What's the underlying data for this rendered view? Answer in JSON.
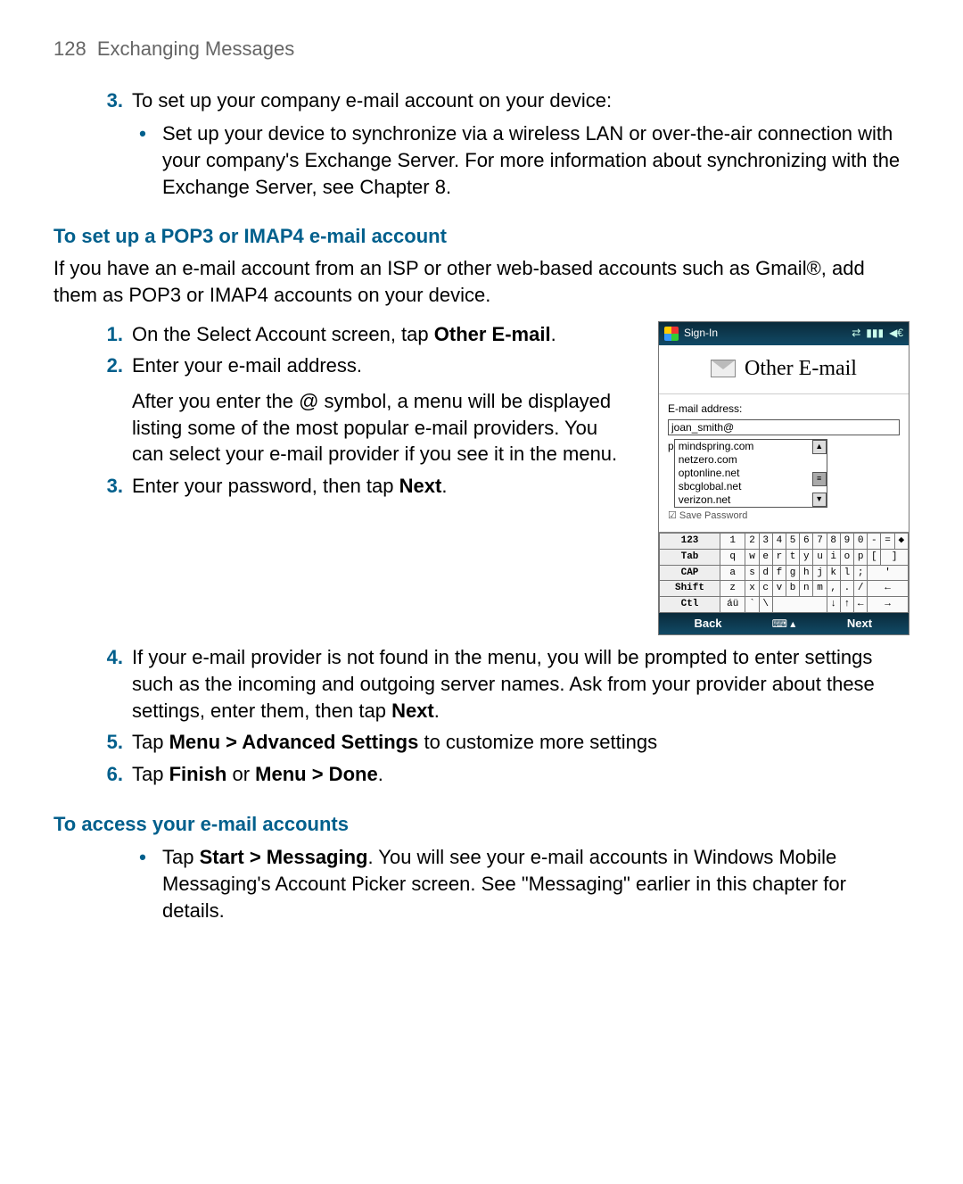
{
  "header": {
    "page_number": "128",
    "title": "Exchanging Messages"
  },
  "step3": {
    "num": "3.",
    "text": "To set up your company e-mail account on your device:",
    "bullet": "Set up your device to synchronize via a wireless LAN or over-the-air connection with your company's Exchange Server. For more information about synchronizing with the Exchange Server, see Chapter 8."
  },
  "sectionA": {
    "heading": "To set up a POP3 or IMAP4 e-mail account",
    "intro": "If you have an e-mail account from an ISP or other web-based accounts such as Gmail®, add them as POP3 or IMAP4 accounts on your device."
  },
  "pop_steps": {
    "s1_num": "1.",
    "s1_a": "On the Select Account screen, tap ",
    "s1_b": "Other E-mail",
    "s1_c": ".",
    "s2_num": "2.",
    "s2_a": "Enter your e-mail address.",
    "s2_b": "After you enter the @ symbol, a menu will be displayed listing some of the most popular e-mail providers. You can select your e-mail provider if you see it in the menu.",
    "s3_num": "3.",
    "s3_a": "Enter your password, then tap ",
    "s3_b": "Next",
    "s3_c": ".",
    "s4_num": "4.",
    "s4_a": "If your e-mail provider is not found in the menu, you will be prompted to enter settings such as the incoming and outgoing server names. Ask from your provider about these settings, enter them, then tap ",
    "s4_b": "Next",
    "s4_c": ".",
    "s5_num": "5.",
    "s5_a": "Tap ",
    "s5_b": "Menu > Advanced Settings",
    "s5_c": " to customize more settings",
    "s6_num": "6.",
    "s6_a": "Tap ",
    "s6_b": "Finish",
    "s6_c": " or ",
    "s6_d": "Menu > Done",
    "s6_e": "."
  },
  "sectionB": {
    "heading": "To access your e-mail accounts",
    "bullet_a": "Tap ",
    "bullet_b": "Start > Messaging",
    "bullet_c": ". You will see your e-mail accounts in Windows Mobile Messaging's Account Picker screen. See \"Messaging\" earlier in this chapter for details."
  },
  "device": {
    "titlebar": "Sign-In",
    "main_title": "Other E-mail",
    "field_label": "E-mail address:",
    "field_value": "joan_smith@",
    "dropdown": [
      "mindspring.com",
      "netzero.com",
      "optonline.net",
      "sbcglobal.net",
      "verizon.net"
    ],
    "password_label": "p",
    "save_pw": "Save Password",
    "soft_left": "Back",
    "soft_right": "Next",
    "kbd": {
      "r1": [
        "123",
        "1",
        "2",
        "3",
        "4",
        "5",
        "6",
        "7",
        "8",
        "9",
        "0",
        "-",
        "=",
        "◆"
      ],
      "r2": [
        "Tab",
        "q",
        "w",
        "e",
        "r",
        "t",
        "y",
        "u",
        "i",
        "o",
        "p",
        "[",
        "]"
      ],
      "r3": [
        "CAP",
        "a",
        "s",
        "d",
        "f",
        "g",
        "h",
        "j",
        "k",
        "l",
        ";",
        "'"
      ],
      "r4": [
        "Shift",
        "z",
        "x",
        "c",
        "v",
        "b",
        "n",
        "m",
        ",",
        ".",
        "/",
        "←"
      ],
      "r5": [
        "Ctl",
        "áü",
        "`",
        "\\",
        " ",
        " ",
        " ",
        " ",
        "↓",
        "↑",
        "←",
        "→"
      ]
    }
  }
}
